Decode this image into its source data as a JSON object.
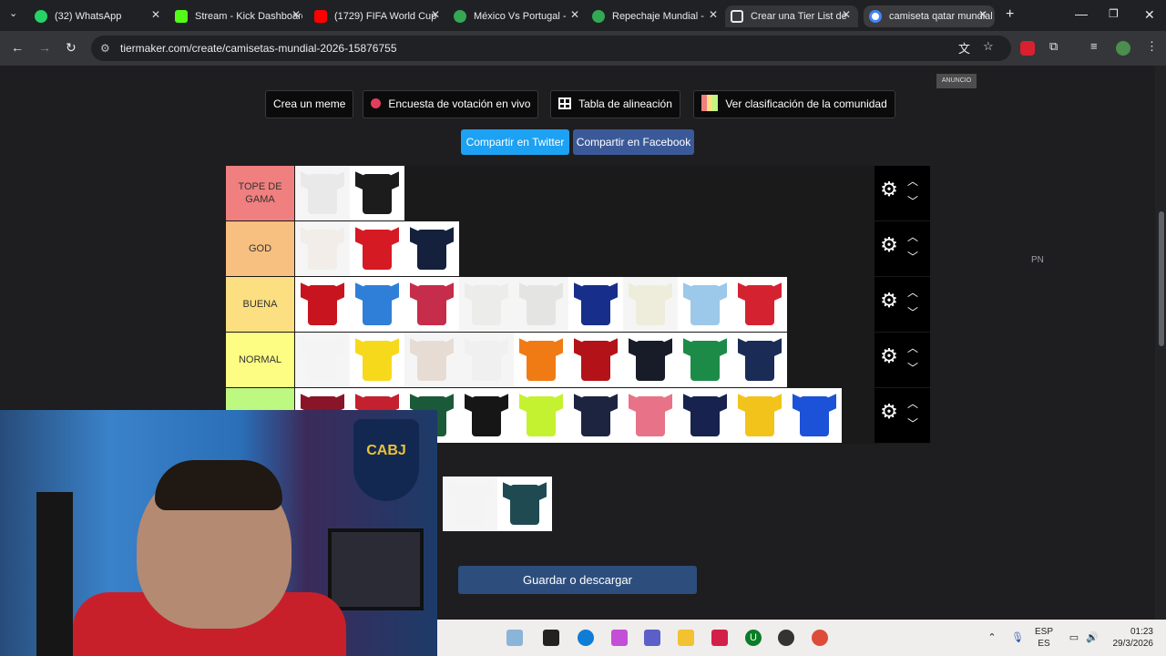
{
  "tabs": [
    {
      "label": "(32) WhatsApp",
      "color": "#25d366"
    },
    {
      "label": "Stream - Kick Dashboard",
      "color": "#53fc18"
    },
    {
      "label": "(1729) FIFA World Cup",
      "color": "#ff0000"
    },
    {
      "label": "México Vs Portugal -",
      "color": "#34a853"
    },
    {
      "label": "Repechaje Mundial -",
      "color": "#34a853"
    },
    {
      "label": "Crear una Tier List de",
      "color": "#e8eaed"
    },
    {
      "label": "camiseta qatar mundial",
      "color": "#4285f4"
    }
  ],
  "url": "tiermaker.com/create/camisetas-mundial-2026-15876755",
  "actions": {
    "meme": "Crea un meme",
    "vote": "Encuesta de votación en vivo",
    "lineup": "Tabla de alineación",
    "community": "Ver clasificación de la comunidad"
  },
  "share": {
    "twitter": "Compartir en Twitter",
    "facebook": "Compartir en Facebook"
  },
  "ad_label": "ANUNCIO",
  "side_label": "PN",
  "tiers": [
    {
      "label": "TOPE DE GAMA",
      "color": "#f07f7f",
      "items": [
        "#e9e9e9",
        "#1c1c1c"
      ]
    },
    {
      "label": "GOD",
      "color": "#f7bf80",
      "items": [
        "#f2ede8",
        "#d61a24",
        "#14203c"
      ]
    },
    {
      "label": "BUENA",
      "color": "#fbdf80",
      "items": [
        "#c8141e",
        "#2f7fd8",
        "#c52d4a",
        "#ececea",
        "#e4e4e2",
        "#172f8a",
        "#eeeddc",
        "#9cc8ea",
        "#d52230"
      ]
    },
    {
      "label": "NORMAL",
      "color": "#fdfd83",
      "items": [
        "#f4f4f4",
        "#f7d91c",
        "#e6dcd4",
        "#f0f0f0",
        "#f07b14",
        "#b41219",
        "#181b28",
        "#1d8b48",
        "#1a2c55"
      ]
    },
    {
      "label": "",
      "color": "#bdf880",
      "items": [
        "#8a1528",
        "#c42030",
        "#1b5a38",
        "#161616",
        "#c4f230",
        "#1c2440",
        "#e87388",
        "#17224e",
        "#f2c31a",
        "#1c52d8"
      ]
    }
  ],
  "pool": [
    "#f4f4f4",
    "#1f4a52"
  ],
  "save_label": "Guardar o descargar",
  "webcam": {
    "logo": "CABJ"
  },
  "taskbar": {
    "lang1": "ESP",
    "lang2": "ES",
    "time": "01:23",
    "date": "29/3/2026"
  }
}
